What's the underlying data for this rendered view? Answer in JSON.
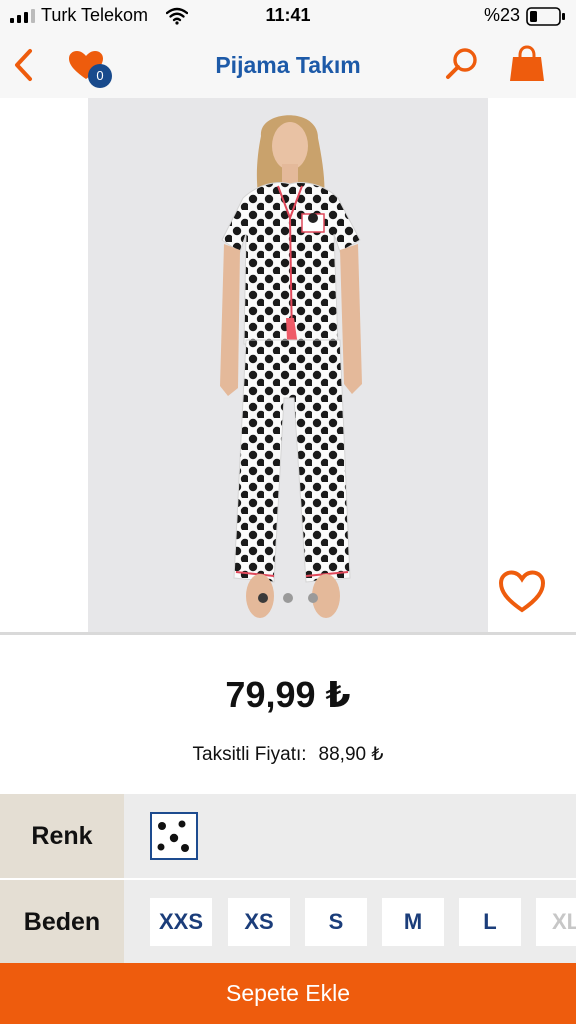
{
  "status_bar": {
    "carrier": "Turk Telekom",
    "time": "11:41",
    "battery": "%23"
  },
  "nav": {
    "title": "Pijama Takım",
    "favorites_count": "0"
  },
  "product": {
    "image_count": 3,
    "active_image": 1,
    "price": "79,99 ₺",
    "installment_label": "Taksitli Fiyatı:",
    "installment_price": "88,90 ₺"
  },
  "options": {
    "color_label": "Renk",
    "size_label": "Beden",
    "sizes": [
      "XXS",
      "XS",
      "S",
      "M",
      "L",
      "XL"
    ]
  },
  "cart_button": {
    "label": "Sepete Ekle"
  },
  "colors": {
    "accent_orange": "#ee5c0d",
    "title_blue": "#1d5aa8",
    "size_blue": "#1b3d7a",
    "badge_blue": "#184a8c"
  }
}
